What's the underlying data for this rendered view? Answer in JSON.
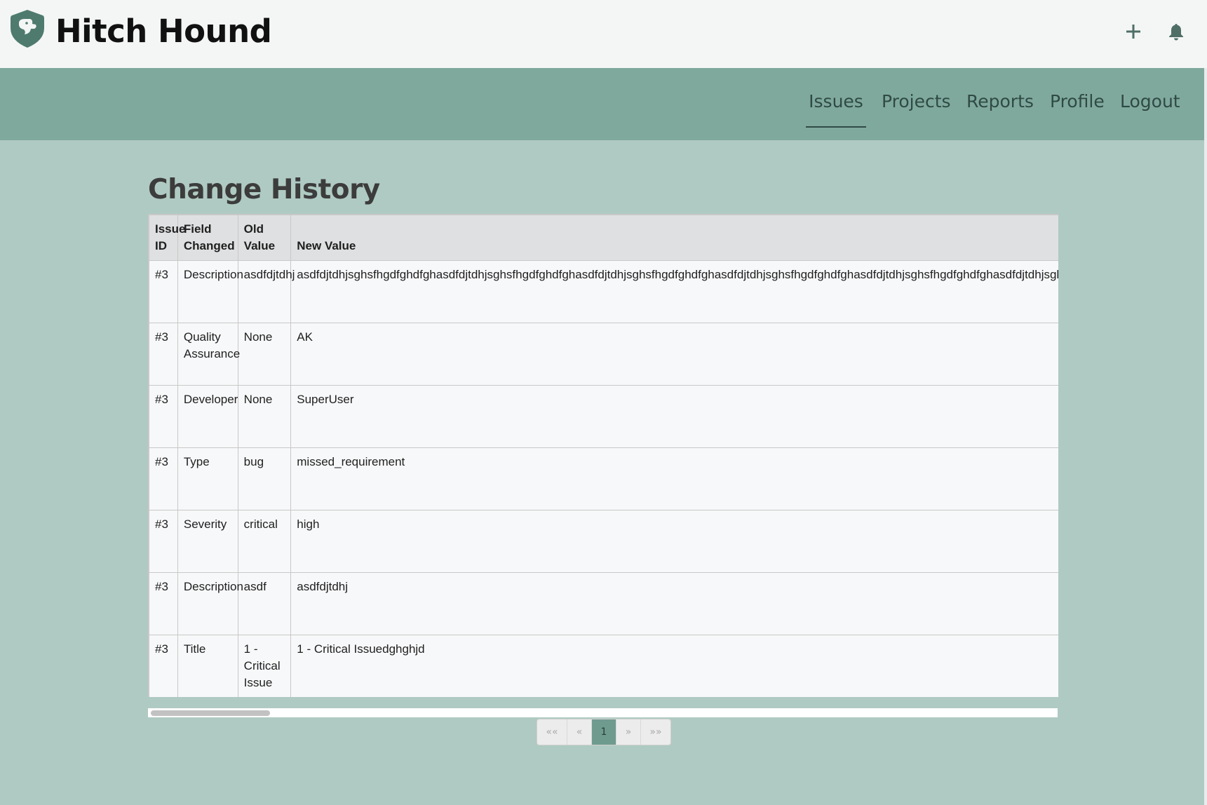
{
  "brand": {
    "name": "Hitch Hound"
  },
  "header": {
    "icons": {
      "add": "plus-icon",
      "notifications": "bell-icon",
      "logo": "shield-dog-icon"
    }
  },
  "nav": {
    "issues": "Issues",
    "projects": "Projects",
    "reports": "Reports",
    "profile": "Profile",
    "logout": "Logout",
    "active": "Issues"
  },
  "page": {
    "title": "Change History"
  },
  "table": {
    "headers": {
      "issue_id": "Issue ID",
      "field": "Field Changed",
      "old": "Old Value",
      "new": "New Value"
    },
    "rows": [
      {
        "issue_id": "#3",
        "field": "Description",
        "old": "asdfdjtdhj",
        "new": "asdfdjtdhjsghsfhgdfghdfghasdfdjtdhjsghsfhgdfghdfghasdfdjtdhjsghsfhgdfghdfghasdfdjtdhjsghsfhgdfghdfghasdfdjtdhjsghsfhgdfghdfghasdfdjtdhjsghsfhgdfghdfgh"
      },
      {
        "issue_id": "#3",
        "field": "Quality Assurance",
        "old": "None",
        "new": "AK"
      },
      {
        "issue_id": "#3",
        "field": "Developer",
        "old": "None",
        "new": "SuperUser"
      },
      {
        "issue_id": "#3",
        "field": "Type",
        "old": "bug",
        "new": "missed_requirement"
      },
      {
        "issue_id": "#3",
        "field": "Severity",
        "old": "critical",
        "new": "high"
      },
      {
        "issue_id": "#3",
        "field": "Description",
        "old": "asdf",
        "new": "asdfdjtdhj"
      },
      {
        "issue_id": "#3",
        "field": "Title",
        "old": "1 - Critical Issue",
        "new": "1 - Critical Issuedghghjd"
      }
    ]
  },
  "pagination": {
    "first": "««",
    "prev": "«",
    "current": "1",
    "next": "»",
    "last": "»»"
  },
  "colors": {
    "navbar": "#80a99d",
    "page_bg": "#afcac2",
    "accent": "#4f7b6e"
  }
}
